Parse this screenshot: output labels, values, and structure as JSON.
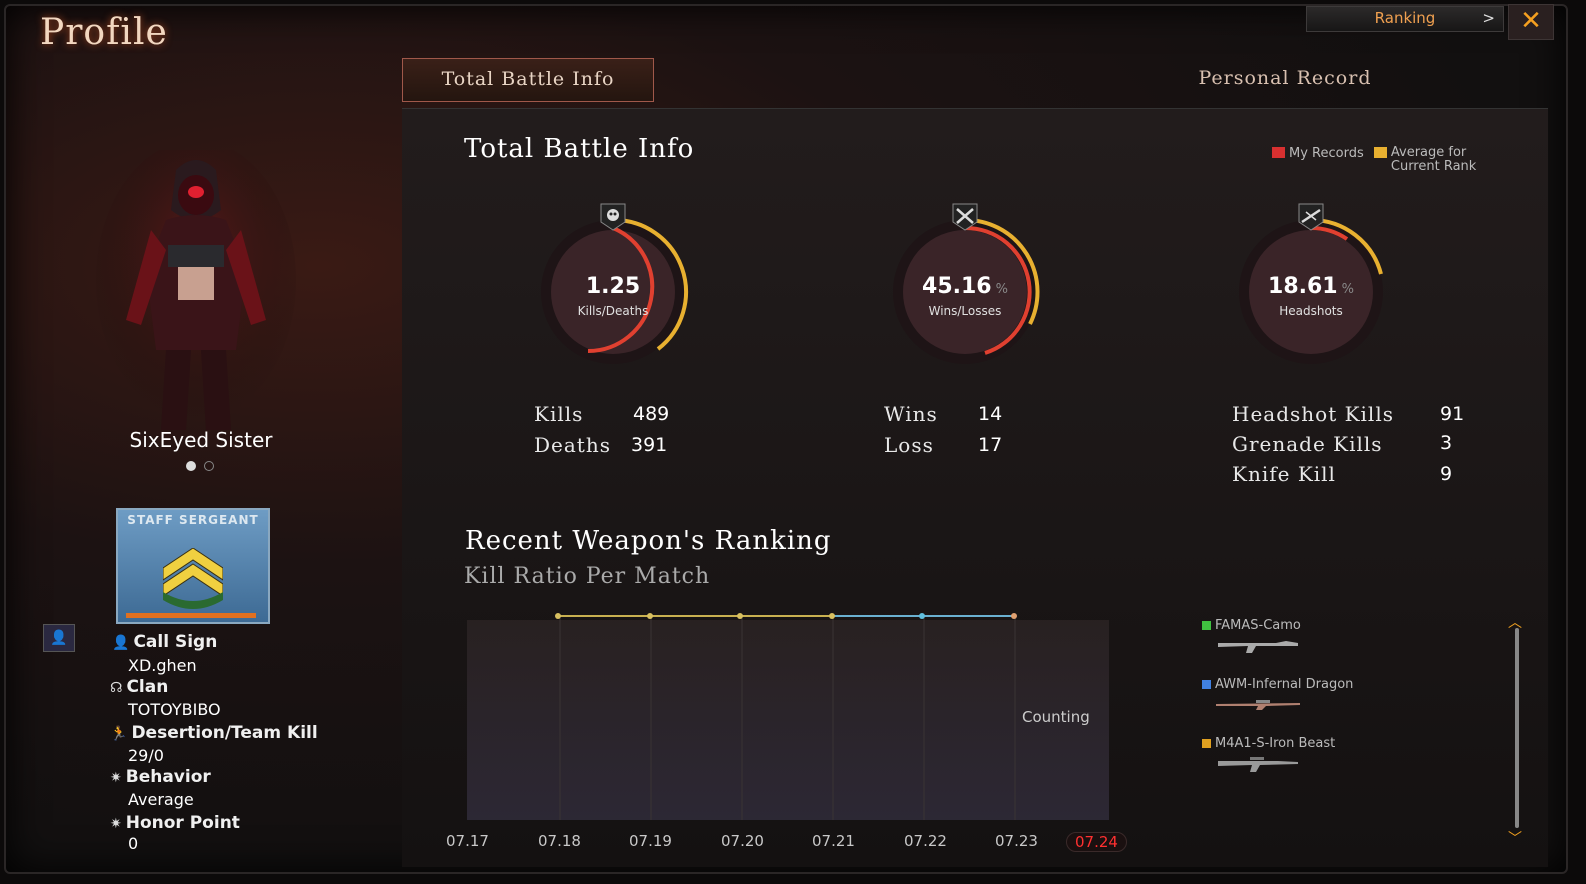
{
  "header": {
    "title": "Profile",
    "ranking_label": "Ranking",
    "ranking_arrow": ">",
    "close_glyph": "✕"
  },
  "tabs": [
    {
      "label": "Total Battle Info",
      "active": true
    },
    {
      "label": "Personal Record",
      "active": false
    }
  ],
  "profile": {
    "character_name": "SixEyed Sister",
    "rank_badge_text": "STAFF SERGEANT",
    "fields": [
      {
        "label": "Call Sign",
        "value": "XD.ghen",
        "icon": "person-icon"
      },
      {
        "label": "Clan",
        "value": "TOTOYBIBO",
        "icon": "clan-icon"
      },
      {
        "label": "Desertion/Team Kill",
        "value": "29/0",
        "icon": "runner-icon"
      },
      {
        "label": "Behavior",
        "value": "Average",
        "icon": "star-icon"
      },
      {
        "label": "Honor Point",
        "value": "0",
        "icon": "star-icon"
      }
    ]
  },
  "battle": {
    "title": "Total Battle Info",
    "legend": {
      "my_records": "My Records",
      "average": "Average for Current Rank",
      "my_color": "#d83030",
      "avg_color": "#e8b030"
    },
    "gauges": [
      {
        "value": "1.25",
        "unit": "",
        "label": "Kills/Deaths",
        "icon": "skull-icon"
      },
      {
        "value": "45.16",
        "unit": "%",
        "label": "Wins/Losses",
        "icon": "crossed-swords-icon"
      },
      {
        "value": "18.61",
        "unit": "%",
        "label": "Headshots",
        "icon": "rifle-icon"
      }
    ],
    "kd_stats": [
      {
        "label": "Kills",
        "value": "489"
      },
      {
        "label": "Deaths",
        "value": "391"
      }
    ],
    "wl_stats": [
      {
        "label": "Wins",
        "value": "14"
      },
      {
        "label": "Loss",
        "value": "17"
      }
    ],
    "hs_stats": [
      {
        "label": "Headshot Kills",
        "value": "91"
      },
      {
        "label": "Grenade Kills",
        "value": "3"
      },
      {
        "label": "Knife Kill",
        "value": "9"
      }
    ]
  },
  "weapon_ranking": {
    "title": "Recent Weapon's Ranking",
    "subtitle": "Kill Ratio Per Match",
    "counting_label": "Counting",
    "dates": [
      "07.17",
      "07.18",
      "07.19",
      "07.20",
      "07.21",
      "07.22",
      "07.23",
      "07.24"
    ],
    "selected_date": "07.24",
    "weapons": [
      {
        "name": "FAMAS-Camo",
        "color": "#40c040"
      },
      {
        "name": "AWM-Infernal Dragon",
        "color": "#4080e0"
      },
      {
        "name": "M4A1-S-Iron Beast",
        "color": "#e0a020"
      }
    ]
  }
}
